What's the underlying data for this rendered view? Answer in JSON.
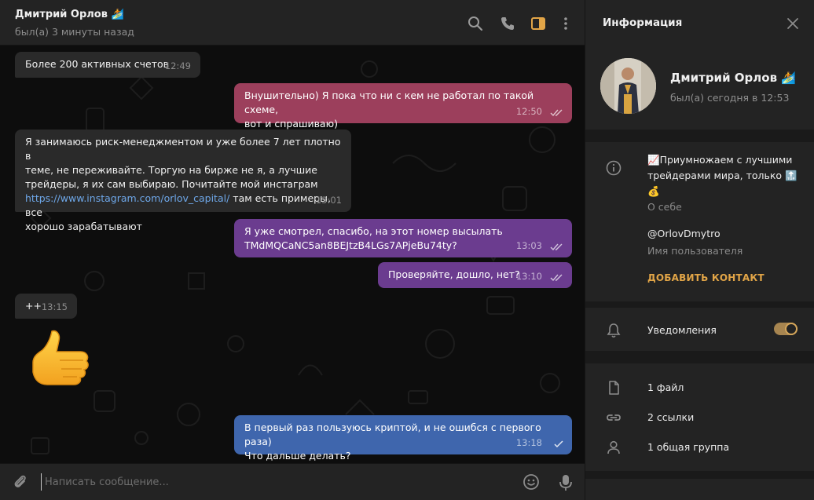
{
  "chat": {
    "header": {
      "name": "Дмитрий Орлов 🏄",
      "status": "был(а) 3 минуты назад",
      "icons": [
        "search-icon",
        "phone-icon",
        "sidebar-panel-icon",
        "more-vert-icon"
      ]
    },
    "messages": [
      {
        "dir": "in",
        "text": "Более 200 активных счетов",
        "time": "12:49"
      },
      {
        "dir": "out",
        "text": "Внушительно) Я пока что ни с кем не работал по такой схеме,\nвот и спрашиваю)",
        "time": "12:50",
        "read": true
      },
      {
        "dir": "in",
        "text_before": "Я занимаюсь риск-менеджментом и уже более 7 лет плотно в\nтеме, не переживайте. Торгую на бирже не я, а лучшие\nтрейдеры, я их сам выбираю. Почитайте мой инстаграм\n",
        "link": "https://www.instagram.com/orlov_capital/",
        "text_after": " там есть примеры, все\nхорошо зарабатывают",
        "time": "13:01"
      },
      {
        "dir": "out",
        "text": "Я уже смотрел, спасибо, на этот номер высылать\nTMdMQCaNC5an8BEJtzB4LGs7APjeBu74ty?",
        "time": "13:03",
        "read": true
      },
      {
        "dir": "out",
        "text": "Проверяйте, дошло, нет?",
        "time": "13:10",
        "read": true
      },
      {
        "dir": "in",
        "text": "++",
        "time": "13:15"
      },
      {
        "dir": "in",
        "sticker": "thumbs-up-sticker"
      },
      {
        "dir": "out",
        "text": "В первый раз пользуюсь криптой, и не ошибся с первого раза)\nЧто дальше делать?",
        "time": "13:18",
        "read": false
      }
    ],
    "composer": {
      "placeholder": "Написать сообщение...",
      "icons": [
        "attach-icon",
        "emoji-icon",
        "microphone-icon"
      ]
    }
  },
  "info": {
    "title": "Информация",
    "name": "Дмитрий Орлов 🏄",
    "status": "был(а) сегодня в 12:53",
    "about": "📈Приумножаем с лучшими трейдерами мира, только 🔝 💰",
    "about_label": "О себе",
    "username": "@OrlovDmytro",
    "username_label": "Имя пользователя",
    "add_contact": "ДОБАВИТЬ КОНТАКТ",
    "notifications_label": "Уведомления",
    "notifications_on": true,
    "media": [
      {
        "icon": "file-icon",
        "label": "1 файл"
      },
      {
        "icon": "link-icon",
        "label": "2 ссылки"
      },
      {
        "icon": "group-icon",
        "label": "1 общая группа"
      }
    ]
  },
  "colors": {
    "accent": "#e2a547",
    "bubble_out_pink": "#9c3f5c",
    "bubble_out_purple": "#6b3c8f",
    "bubble_out_blue": "#3f66ad",
    "bubble_in": "#2a2a2a"
  }
}
